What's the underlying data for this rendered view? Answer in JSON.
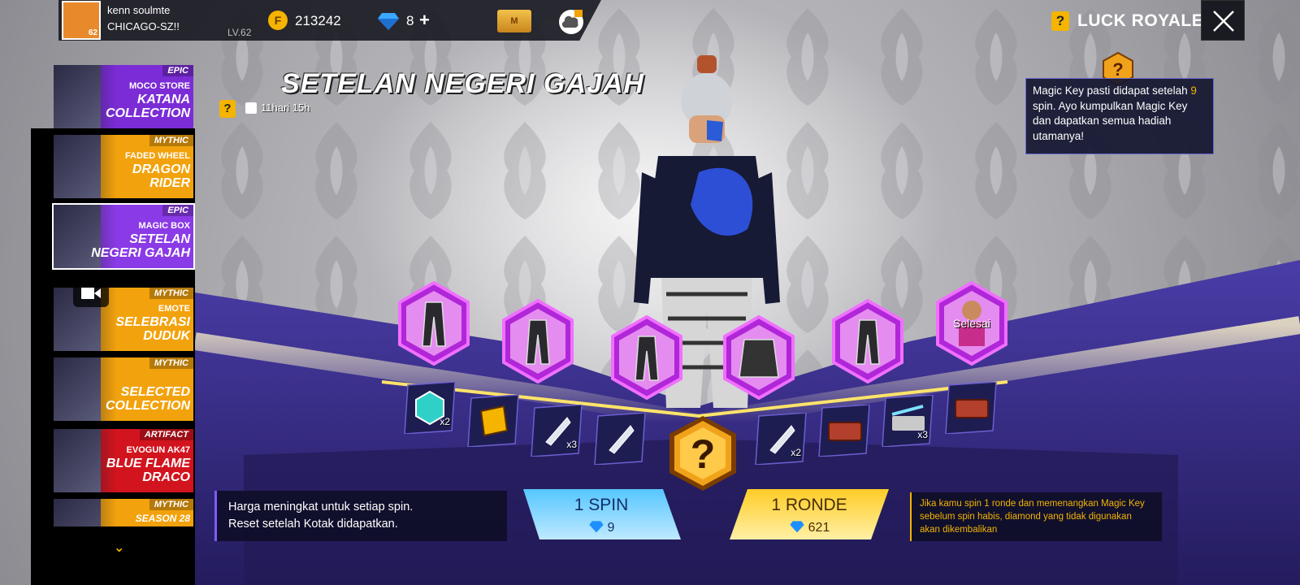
{
  "player": {
    "name": "kenn soulmte",
    "guild": "CHICAGO-SZ!!",
    "avatar_level": "62",
    "level": "LV.62"
  },
  "currency": {
    "coins": "213242",
    "coin_symbol": "F",
    "diamonds": "8",
    "diamond_add": "+"
  },
  "membership_badge": "M",
  "header": {
    "help": "?",
    "title": "LUCK ROYALE"
  },
  "sidebar": {
    "items": [
      {
        "rarity": "EPIC",
        "sub": "MOCO STORE",
        "main": "KATANA\nCOLLECTION",
        "color": "#7b2cd6"
      },
      {
        "rarity": "MYTHIC",
        "sub": "FADED WHEEL",
        "main": "DRAGON\nRIDER",
        "color": "#f2a20c"
      },
      {
        "rarity": "EPIC",
        "sub": "MAGIC BOX",
        "main": "SETELAN\nNEGERI GAJAH",
        "color": "#8a3ae6"
      },
      {
        "rarity": "MYTHIC",
        "sub": "EMOTE",
        "main": "SELEBRASI\nDUDUK",
        "color": "#f2a20c"
      },
      {
        "rarity": "MYTHIC",
        "sub": "",
        "main": "SELECTED\nCOLLECTION",
        "color": "#f2a20c"
      },
      {
        "rarity": "ARTIFACT",
        "sub": "EVOGUN AK47",
        "main": "BLUE FLAME\nDRACO",
        "color": "#d2141e"
      },
      {
        "rarity": "MYTHIC",
        "sub": "",
        "main": "SEASON 28",
        "color": "#f2a20c"
      }
    ]
  },
  "event": {
    "title": "SETELAN NEGERI GAJAH",
    "help": "?",
    "timer": "11hari 15h"
  },
  "tooltip": {
    "text_before": "Magic Key pasti didapat setelah ",
    "highlight": "9",
    "text_after": " spin. Ayo kumpulkan Magic Key dan dapatkan semua hadiah utamanya!"
  },
  "grand_rewards": [
    {
      "name": "pants-reward-1",
      "label": ""
    },
    {
      "name": "pants-reward-2",
      "label": ""
    },
    {
      "name": "pants-reward-3",
      "label": ""
    },
    {
      "name": "jacket-reward",
      "label": ""
    },
    {
      "name": "pants-reward-4",
      "label": ""
    },
    {
      "name": "head-reward",
      "label": "Selesai"
    }
  ],
  "reward_tiles": [
    {
      "icon": "token-icon",
      "qty": "x2"
    },
    {
      "icon": "voucher-icon",
      "qty": ""
    },
    {
      "icon": "feather-icon",
      "qty": "x3"
    },
    {
      "icon": "feather-icon",
      "qty": ""
    },
    {
      "icon": "feather-icon",
      "qty": "x2"
    },
    {
      "icon": "crate-icon",
      "qty": ""
    },
    {
      "icon": "weapon-crate-icon",
      "qty": "x3"
    },
    {
      "icon": "crate-icon",
      "qty": ""
    }
  ],
  "center_key": "?",
  "price_note": {
    "line1": "Harga meningkat untuk setiap spin.",
    "line2": "Reset setelah Kotak didapatkan."
  },
  "spin": {
    "label": "1 SPIN",
    "cost": "9"
  },
  "round": {
    "label": "1 RONDE",
    "cost": "621"
  },
  "round_note": "Jika kamu spin 1 ronde dan memenangkan Magic Key sebelum spin habis, diamond yang tidak digunakan akan dikembalikan",
  "colors": {
    "gold": "#f4b400",
    "purple_floor": "#3a2f86",
    "hex_magenta": "#e046ff",
    "spin_blue": "#3fb4ff",
    "round_gold": "#ffc21a"
  }
}
